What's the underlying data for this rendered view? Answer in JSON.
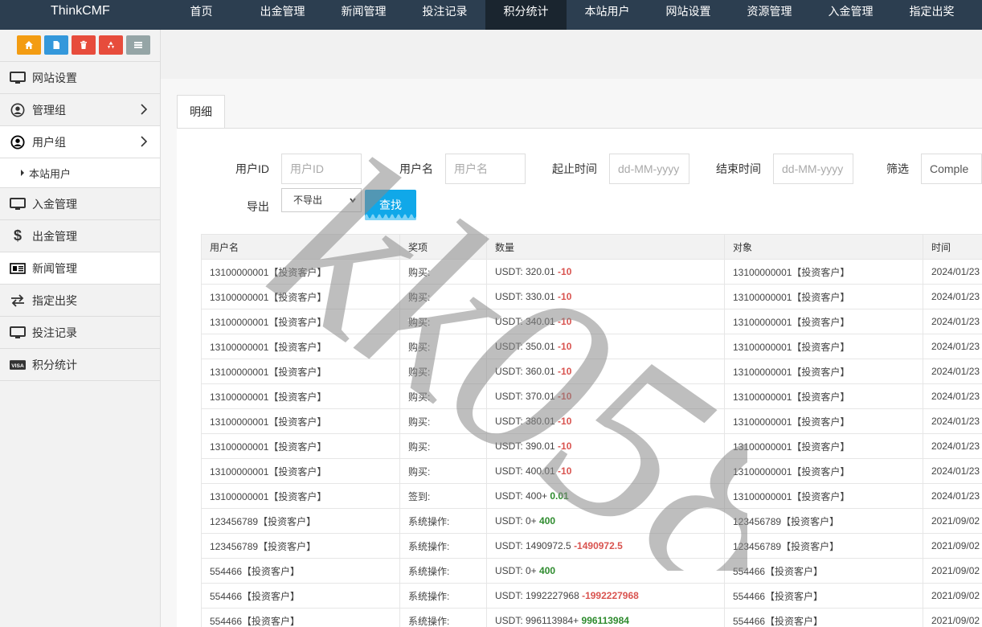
{
  "app": {
    "brand": "ThinkCMF"
  },
  "topnav": {
    "items": [
      "首页",
      "出金管理",
      "新闻管理",
      "投注记录",
      "积分统计",
      "本站用户",
      "网站设置",
      "资源管理",
      "入金管理",
      "指定出奖"
    ],
    "active": "积分统计"
  },
  "colors": {
    "topbar": "#2c3e50",
    "accent": "#10a8e9",
    "negative": "#d9534f",
    "positive": "#2e8b2e"
  },
  "shortcuts": [
    {
      "icon": "home-icon",
      "color": "#f39c12"
    },
    {
      "icon": "file-icon",
      "color": "#3498db"
    },
    {
      "icon": "trash-icon",
      "color": "#e74c3c"
    },
    {
      "icon": "recycle-icon",
      "color": "#e74c3c"
    },
    {
      "icon": "list-icon",
      "color": "#95a5a6"
    }
  ],
  "sidebar": {
    "items": [
      {
        "label": "网站设置",
        "icon": "monitor-icon"
      },
      {
        "label": "管理组",
        "icon": "user-circle-icon"
      },
      {
        "label": "用户组",
        "icon": "user-circle-icon"
      },
      {
        "label": "入金管理",
        "icon": "monitor-icon"
      },
      {
        "label": "出金管理",
        "icon": "dollar-icon"
      },
      {
        "label": "新闻管理",
        "icon": "newspaper-icon"
      },
      {
        "label": "指定出奖",
        "icon": "exchange-icon"
      },
      {
        "label": "投注记录",
        "icon": "monitor-icon"
      },
      {
        "label": "积分统计",
        "icon": "visa-icon"
      }
    ],
    "sub_item": "本站用户"
  },
  "tab": {
    "label": "明细"
  },
  "filters": {
    "user_id_label": "用户ID",
    "user_id_placeholder": "用户ID",
    "username_label": "用户名",
    "username_placeholder": "用户名",
    "start_label": "起止时间",
    "start_placeholder": "dd-MM-yyyy",
    "end_label": "结束时间",
    "end_placeholder": "dd-MM-yyyy",
    "filter_label": "筛选",
    "filter_value": "Comple",
    "export_label": "导出",
    "export_value": "不导出",
    "search_button": "查找"
  },
  "table": {
    "headers": [
      "用户名",
      "奖项",
      "数量",
      "对象",
      "时间"
    ],
    "rows": [
      {
        "user": "13100000001【投资客户】",
        "award": "购买:",
        "amount": "USDT: 320.01 ",
        "delta": "-10",
        "sign": "neg",
        "target": "13100000001【投资客户】",
        "time": "2024/01/23"
      },
      {
        "user": "13100000001【投资客户】",
        "award": "购买:",
        "amount": "USDT: 330.01 ",
        "delta": "-10",
        "sign": "neg",
        "target": "13100000001【投资客户】",
        "time": "2024/01/23"
      },
      {
        "user": "13100000001【投资客户】",
        "award": "购买:",
        "amount": "USDT: 340.01 ",
        "delta": "-10",
        "sign": "neg",
        "target": "13100000001【投资客户】",
        "time": "2024/01/23"
      },
      {
        "user": "13100000001【投资客户】",
        "award": "购买:",
        "amount": "USDT: 350.01 ",
        "delta": "-10",
        "sign": "neg",
        "target": "13100000001【投资客户】",
        "time": "2024/01/23"
      },
      {
        "user": "13100000001【投资客户】",
        "award": "购买:",
        "amount": "USDT: 360.01 ",
        "delta": "-10",
        "sign": "neg",
        "target": "13100000001【投资客户】",
        "time": "2024/01/23"
      },
      {
        "user": "13100000001【投资客户】",
        "award": "购买:",
        "amount": "USDT: 370.01 ",
        "delta": "-10",
        "sign": "neg",
        "target": "13100000001【投资客户】",
        "time": "2024/01/23"
      },
      {
        "user": "13100000001【投资客户】",
        "award": "购买:",
        "amount": "USDT: 380.01 ",
        "delta": "-10",
        "sign": "neg",
        "target": "13100000001【投资客户】",
        "time": "2024/01/23"
      },
      {
        "user": "13100000001【投资客户】",
        "award": "购买:",
        "amount": "USDT: 390.01 ",
        "delta": "-10",
        "sign": "neg",
        "target": "13100000001【投资客户】",
        "time": "2024/01/23"
      },
      {
        "user": "13100000001【投资客户】",
        "award": "购买:",
        "amount": "USDT: 400.01 ",
        "delta": "-10",
        "sign": "neg",
        "target": "13100000001【投资客户】",
        "time": "2024/01/23"
      },
      {
        "user": "13100000001【投资客户】",
        "award": "签到:",
        "amount": "USDT: 400+ ",
        "delta": "0.01",
        "sign": "pos",
        "target": "13100000001【投资客户】",
        "time": "2024/01/23"
      },
      {
        "user": "123456789【投资客户】",
        "award": "系统操作:",
        "amount": "USDT: 0+ ",
        "delta": "400",
        "sign": "pos",
        "target": "123456789【投资客户】",
        "time": "2021/09/02"
      },
      {
        "user": "123456789【投资客户】",
        "award": "系统操作:",
        "amount": "USDT: 1490972.5 ",
        "delta": "-1490972.5",
        "sign": "neg",
        "target": "123456789【投资客户】",
        "time": "2021/09/02"
      },
      {
        "user": "554466【投资客户】",
        "award": "系统操作:",
        "amount": "USDT: 0+ ",
        "delta": "400",
        "sign": "pos",
        "target": "554466【投资客户】",
        "time": "2021/09/02"
      },
      {
        "user": "554466【投资客户】",
        "award": "系统操作:",
        "amount": "USDT: 1992227968 ",
        "delta": "-1992227968",
        "sign": "neg",
        "target": "554466【投资客户】",
        "time": "2021/09/02"
      },
      {
        "user": "554466【投资客户】",
        "award": "系统操作:",
        "amount": "USDT: 996113984+ ",
        "delta": "996113984",
        "sign": "pos",
        "target": "554466【投资客户】",
        "time": "2021/09/02"
      }
    ]
  },
  "watermark": "kk058"
}
